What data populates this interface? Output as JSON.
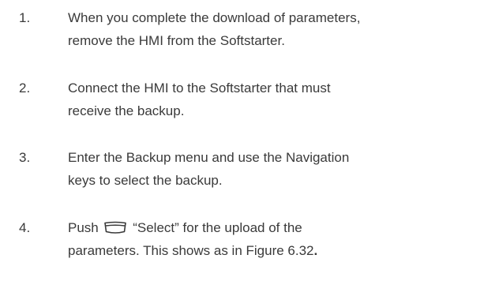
{
  "steps": [
    {
      "number": "1.",
      "lines": [
        "When you complete the download of parameters,",
        "remove the HMI from the Softstarter."
      ]
    },
    {
      "number": "2.",
      "lines": [
        "Connect the HMI to the Softstarter that must",
        "receive the backup."
      ]
    },
    {
      "number": "3.",
      "lines": [
        "Enter the Backup menu and use the Navigation",
        "keys to select the backup."
      ]
    },
    {
      "number": "4.",
      "line1_before_icon": "Push",
      "line1_after_icon": "“Select” for the upload of the",
      "line2": "parameters. This shows as in Figure 6.32",
      "line2_end": "."
    }
  ],
  "icons": {
    "select_key": "selection-key-icon"
  }
}
